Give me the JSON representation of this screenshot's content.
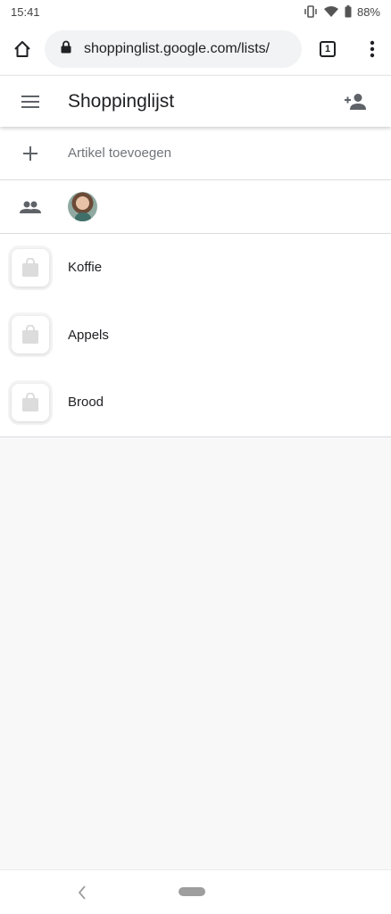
{
  "status_bar": {
    "time": "15:41",
    "battery": "88%",
    "icons": [
      "vibrate-icon",
      "wifi-icon",
      "battery-icon"
    ]
  },
  "browser": {
    "url": "shoppinglist.google.com/lists/",
    "tab_count": "1",
    "icons": [
      "home-icon",
      "lock-icon",
      "tabs-icon",
      "more-vert-icon"
    ]
  },
  "app_bar": {
    "title": "Shoppinglijst",
    "icons": [
      "menu-icon",
      "person-add-icon"
    ]
  },
  "list": {
    "add_item_label": "Artikel toevoegen",
    "items": [
      {
        "label": "Koffie",
        "icon": "shopping-bag-icon"
      },
      {
        "label": "Appels",
        "icon": "shopping-bag-icon"
      },
      {
        "label": "Brood",
        "icon": "shopping-bag-icon"
      }
    ]
  },
  "nav_bar": {
    "icons": [
      "back-icon",
      "home-pill"
    ]
  },
  "colors": {
    "background": "#f8f8f8",
    "surface": "#ffffff",
    "icon": "#5f6368",
    "divider": "#dadce0"
  }
}
